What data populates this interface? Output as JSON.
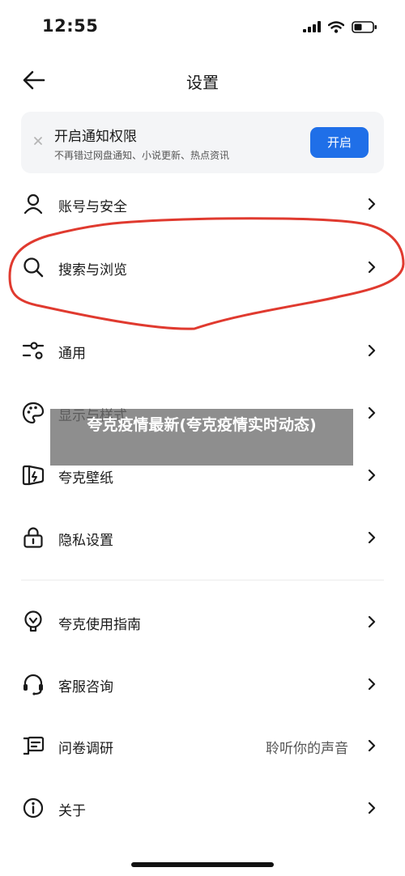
{
  "status": {
    "time": "12:55"
  },
  "header": {
    "title": "设置"
  },
  "banner": {
    "title": "开启通知权限",
    "subtitle": "不再错过网盘通知、小说更新、热点资讯",
    "button_label": "开启"
  },
  "menu": [
    {
      "label": "账号与安全",
      "icon": "person-icon"
    },
    {
      "label": "搜索与浏览",
      "icon": "search-icon"
    },
    {
      "label": "通用",
      "icon": "sliders-icon"
    },
    {
      "label": "显示与样式",
      "icon": "palette-icon"
    },
    {
      "label": "夸克壁纸",
      "icon": "wallpaper-icon"
    },
    {
      "label": "隐私设置",
      "icon": "lock-icon"
    },
    {
      "label": "夸克使用指南",
      "icon": "lightbulb-icon"
    },
    {
      "label": "客服咨询",
      "icon": "headset-icon"
    },
    {
      "label": "问卷调研",
      "value": "聆听你的声音",
      "icon": "survey-icon"
    },
    {
      "label": "关于",
      "icon": "info-icon"
    }
  ],
  "overlay": {
    "text": "夸克疫情最新(夸克疫情实时动态)"
  },
  "colors": {
    "accent": "#1f6fe8",
    "annotation": "#e03a2f",
    "overlay": "#6e6e6e"
  }
}
